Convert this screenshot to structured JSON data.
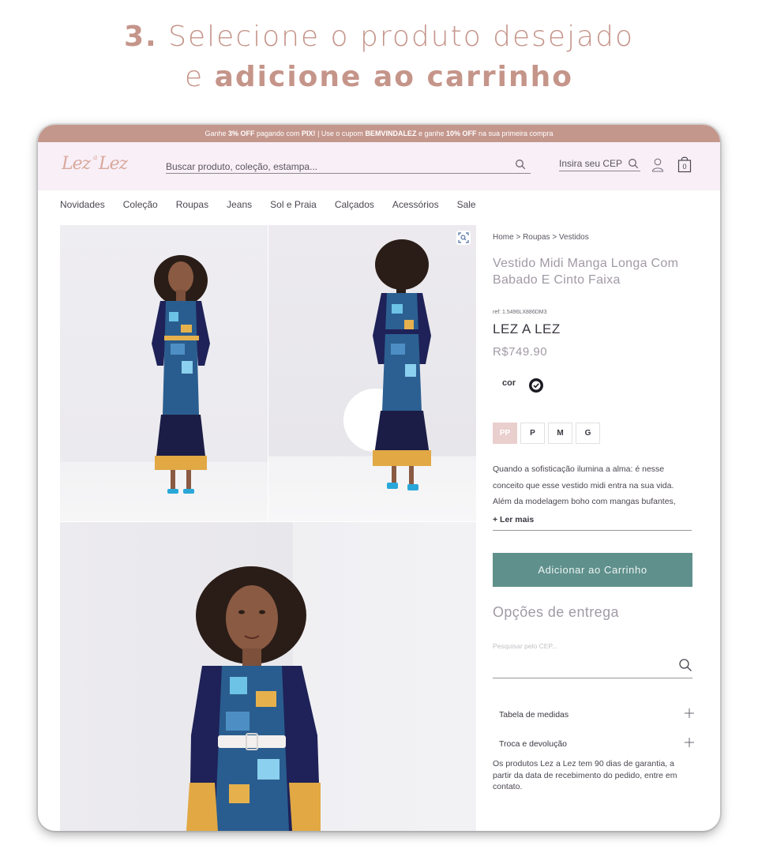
{
  "heading": {
    "line1_num": "3.",
    "line1_text": "Selecione o produto desejado",
    "line2_text": "e",
    "line2_bold": "adicione ao carrinho"
  },
  "promo": {
    "p1": "Ganhe ",
    "b1": "3% OFF",
    "p2": " pagando com ",
    "b2": "PIX!",
    "p3": " | Use o cupom ",
    "b3": "BEMVINDALEZ",
    "p4": " e ganhe ",
    "b4": "10% OFF",
    "p5": " na sua primeira compra"
  },
  "header": {
    "logo": "Lez a Lez",
    "search_placeholder": "Buscar produto, coleção, estampa...",
    "cep_label": "Insira seu CEP",
    "icons": [
      "search-icon",
      "user-icon",
      "bag-icon"
    ],
    "bag_count": "0"
  },
  "nav": {
    "items": [
      "Novidades",
      "Coleção",
      "Roupas",
      "Jeans",
      "Sol e Praia",
      "Calçados",
      "Acessórios",
      "Sale"
    ]
  },
  "product": {
    "breadcrumb": "Home > Roupas > Vestidos",
    "title": "Vestido Midi Manga Longa Com Babado E Cinto Faixa",
    "ref": "ref: 1.5496LX886DM3",
    "brand": "LEZ A LEZ",
    "price": "R$749.90",
    "color_label": "cor",
    "sizes": [
      "PP",
      "P",
      "M",
      "G"
    ],
    "selected_size": "PP",
    "description": "Quando a sofisticação ilumina a alma: é nesse conceito que esse vestido midi entra na sua vida. Além da modelagem boho com mangas bufantes,",
    "read_more": "+ Ler mais",
    "add_to_cart": "Adicionar ao Carrinho"
  },
  "delivery": {
    "title": "Opções de entrega",
    "cep_placeholder": "Pesquisar pelo CEP..."
  },
  "accordion": {
    "sizes_table": "Tabela de medidas",
    "returns": "Troca e devolução",
    "returns_text": "Os produtos Lez a Lez tem 90 dias de garantia, a partir da data de recebimento do pedido, entre em contato."
  },
  "colors": {
    "accent": "#c4978d",
    "cart_button": "#5f908c",
    "topbar_bg": "#f8eff7"
  }
}
